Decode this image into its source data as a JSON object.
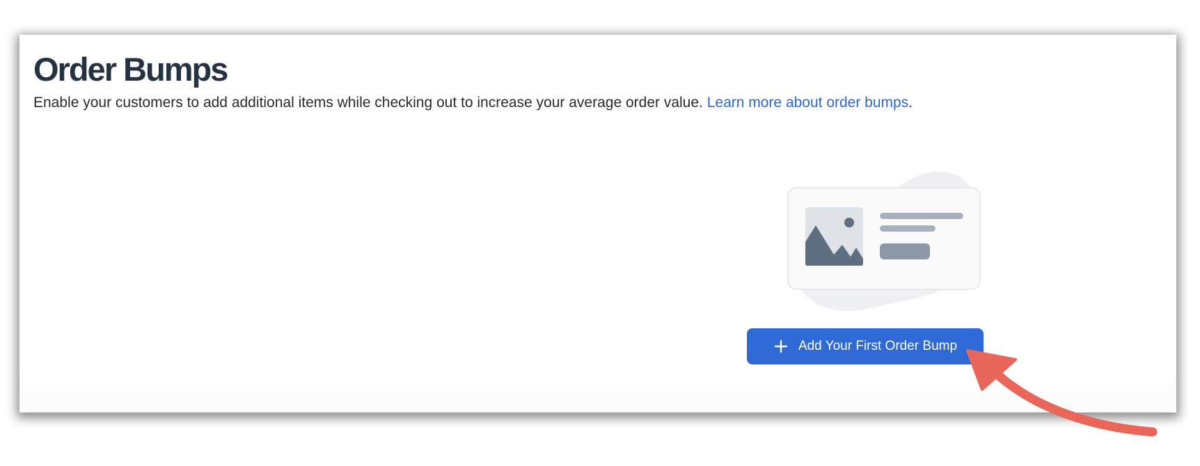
{
  "header": {
    "title": "Order Bumps",
    "description": "Enable your customers to add additional items while checking out to increase your average order value.",
    "learn_more_link": "Learn more about order bumps",
    "trailing_period": "."
  },
  "empty_state": {
    "illustration_icon": "image-card-placeholder-icon",
    "button_label": "Add Your First Order Bump",
    "button_icon": "plus-icon"
  },
  "annotation": {
    "arrow_color": "#e8665a"
  },
  "colors": {
    "accent": "#2e69d5",
    "link": "#2c67d0",
    "title": "#253242"
  }
}
